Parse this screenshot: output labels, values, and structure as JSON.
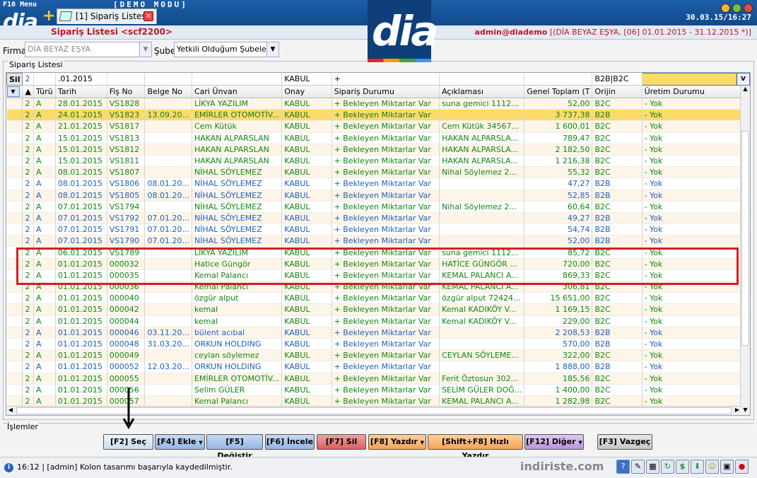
{
  "app": {
    "menu": "F10 Menu",
    "demo": "[DEMO  MODU]",
    "clock": "30.03.15/16:27",
    "logo": "dia",
    "tab_label": "[1] Sipariş Listesi"
  },
  "titlebar": {
    "title": "Sipariş Listesi <scf2200>",
    "user": "admin@diademo",
    "context": "[(DİA BEYAZ EŞYA, [06] 01.01.2015 - 31.12.2015 *)]"
  },
  "filters": {
    "firma_label": "Firma",
    "firma_value": "DİA BEYAZ EŞYA",
    "sube_label": "Şube",
    "sube_value": "Yetkili Olduğum Şubeler"
  },
  "section_label": "Sipariş Listesi",
  "filter_row": {
    "sil": "Sil",
    "date": ".01.2015",
    "onay": "KABUL",
    "durum": "+",
    "orijin": "B2B|B2C",
    "v": "v"
  },
  "columns": [
    "Türü",
    "Tarih",
    "Fiş No",
    "Belge No",
    "Cari Ünvan",
    "Onay",
    "Sipariş Durumu",
    "Açıklaması",
    "Genel Toplam (T",
    "Orijin",
    "Üretim Durumu"
  ],
  "rows": [
    {
      "c": "g",
      "t": "A",
      "d": "28.01.2015",
      "f": "VS1828",
      "b": "",
      "u": "LİKYA YAZILIM",
      "o": "KABUL",
      "s": "+ Bekleyen Miktarlar Var",
      "a": "suna gemici  1112...",
      "g2": "52,00",
      "r": "B2C",
      "p": "- Yok"
    },
    {
      "c": "g",
      "t": "A",
      "d": "24.01.2015",
      "f": "VS1823",
      "b": "13.09.20...",
      "u": "EMİRLER OTOMOTİV...",
      "o": "KABUL",
      "s": "+ Bekleyen Miktarlar Var",
      "a": "",
      "g2": "3 737,38",
      "r": "B2B",
      "p": "- Yok"
    },
    {
      "c": "g",
      "t": "A",
      "d": "21.01.2015",
      "f": "VS1817",
      "b": "",
      "u": "Cem Kütük",
      "o": "KABUL",
      "s": "+ Bekleyen Miktarlar Var",
      "a": "Cem Kütük  34567...",
      "g2": "1 600,01",
      "r": "B2C",
      "p": "- Yok"
    },
    {
      "c": "g",
      "t": "A",
      "d": "15.01.2015",
      "f": "VS1813",
      "b": "",
      "u": "HAKAN ALPARSLAN",
      "o": "KABUL",
      "s": "+ Bekleyen Miktarlar Var",
      "a": "HAKAN ALPARSLA...",
      "g2": "789,47",
      "r": "B2C",
      "p": "- Yok"
    },
    {
      "c": "g",
      "t": "A",
      "d": "15.01.2015",
      "f": "VS1812",
      "b": "",
      "u": "HAKAN ALPARSLAN",
      "o": "KABUL",
      "s": "+ Bekleyen Miktarlar Var",
      "a": "HAKAN ALPARSLA...",
      "g2": "2 182,50",
      "r": "B2C",
      "p": "- Yok"
    },
    {
      "c": "g",
      "t": "A",
      "d": "15.01.2015",
      "f": "VS1811",
      "b": "",
      "u": "HAKAN ALPARSLAN",
      "o": "KABUL",
      "s": "+ Bekleyen Miktarlar Var",
      "a": "HAKAN ALPARSLA...",
      "g2": "1 216,38",
      "r": "B2C",
      "p": "- Yok"
    },
    {
      "c": "g",
      "t": "A",
      "d": "08.01.2015",
      "f": "VS1807",
      "b": "",
      "u": "NİHAL SÖYLEMEZ",
      "o": "KABUL",
      "s": "+ Bekleyen Miktarlar Var",
      "a": "Nihal Söylemez  2...",
      "g2": "55,32",
      "r": "B2C",
      "p": "- Yok"
    },
    {
      "c": "b",
      "t": "A",
      "d": "08.01.2015",
      "f": "VS1806",
      "b": "08.01.20...",
      "u": "NİHAL SÖYLEMEZ",
      "o": "KABUL",
      "s": "+ Bekleyen Miktarlar Var",
      "a": "",
      "g2": "47,27",
      "r": "B2B",
      "p": "- Yok"
    },
    {
      "c": "b",
      "t": "A",
      "d": "08.01.2015",
      "f": "VS1805",
      "b": "08.01.20...",
      "u": "NİHAL SÖYLEMEZ",
      "o": "KABUL",
      "s": "+ Bekleyen Miktarlar Var",
      "a": "",
      "g2": "52,85",
      "r": "B2B",
      "p": "- Yok"
    },
    {
      "c": "g",
      "t": "A",
      "d": "07.01.2015",
      "f": "VS1794",
      "b": "",
      "u": "NİHAL SÖYLEMEZ",
      "o": "KABUL",
      "s": "+ Bekleyen Miktarlar Var",
      "a": "Nihal Söylemez  2...",
      "g2": "60,64",
      "r": "B2C",
      "p": "- Yok"
    },
    {
      "c": "b",
      "t": "A",
      "d": "07.01.2015",
      "f": "VS1792",
      "b": "07.01.20...",
      "u": "NİHAL SÖYLEMEZ",
      "o": "KABUL",
      "s": "+ Bekleyen Miktarlar Var",
      "a": "",
      "g2": "49,27",
      "r": "B2B",
      "p": "- Yok"
    },
    {
      "c": "b",
      "t": "A",
      "d": "07.01.2015",
      "f": "VS1791",
      "b": "07.01.20...",
      "u": "NİHAL SÖYLEMEZ",
      "o": "KABUL",
      "s": "+ Bekleyen Miktarlar Var",
      "a": "",
      "g2": "54,74",
      "r": "B2B",
      "p": "- Yok"
    },
    {
      "c": "b",
      "t": "A",
      "d": "07.01.2015",
      "f": "VS1790",
      "b": "07.01.20...",
      "u": "NİHAL SÖYLEMEZ",
      "o": "KABUL",
      "s": "+ Bekleyen Miktarlar Var",
      "a": "",
      "g2": "52,00",
      "r": "B2B",
      "p": "- Yok"
    },
    {
      "c": "g",
      "t": "A",
      "d": "06.01.2015",
      "f": "VS1789",
      "b": "",
      "u": "LİKYA YAZILIM",
      "o": "KABUL",
      "s": "+ Bekleyen Miktarlar Var",
      "a": "suna gemici  1112...",
      "g2": "85,72",
      "r": "B2C",
      "p": "- Yok"
    },
    {
      "c": "g",
      "t": "A",
      "d": "01.01.2015",
      "f": "000032",
      "b": "",
      "u": "Hatice Güngör",
      "o": "KABUL",
      "s": "+ Bekleyen Miktarlar Var",
      "a": "HATİCE GÜNGÖR  ...",
      "g2": "720,00",
      "r": "B2C",
      "p": "- Yok"
    },
    {
      "c": "g",
      "t": "A",
      "d": "01.01.2015",
      "f": "000035",
      "b": "",
      "u": "Kemal Palancı",
      "o": "KABUL",
      "s": "+ Bekleyen Miktarlar Var",
      "a": "KEMAL PALANCI A...",
      "g2": "869,33",
      "r": "B2C",
      "p": "- Yok"
    },
    {
      "c": "g",
      "t": "A",
      "d": "01.01.2015",
      "f": "000036",
      "b": "",
      "u": "Kemal Palancı",
      "o": "KABUL",
      "s": "+ Bekleyen Miktarlar Var",
      "a": "KEMAL PALANCI A...",
      "g2": "306,81",
      "r": "B2C",
      "p": "- Yok"
    },
    {
      "c": "g",
      "t": "A",
      "d": "01.01.2015",
      "f": "000040",
      "b": "",
      "u": "özgür alput",
      "o": "KABUL",
      "s": "+ Bekleyen Miktarlar Var",
      "a": "özgür alput  72424...",
      "g2": "15 651,00",
      "r": "B2C",
      "p": "- Yok"
    },
    {
      "c": "g",
      "t": "A",
      "d": "01.01.2015",
      "f": "000042",
      "b": "",
      "u": "kemal",
      "o": "KABUL",
      "s": "+ Bekleyen Miktarlar Var",
      "a": "Kemal KADIKÖY V...",
      "g2": "1 169,15",
      "r": "B2C",
      "p": "- Yok"
    },
    {
      "c": "g",
      "t": "A",
      "d": "01.01.2015",
      "f": "000044",
      "b": "",
      "u": "kemal",
      "o": "KABUL",
      "s": "+ Bekleyen Miktarlar Var",
      "a": "Kemal KADIKÖY V...",
      "g2": "229,00",
      "r": "B2C",
      "p": "- Yok"
    },
    {
      "c": "b",
      "t": "A",
      "d": "01.01.2015",
      "f": "000046",
      "b": "03.11.20...",
      "u": "bülent acıbal",
      "o": "KABUL",
      "s": "+ Bekleyen Miktarlar Var",
      "a": "",
      "g2": "2 208,53",
      "r": "B2B",
      "p": "- Yok"
    },
    {
      "c": "b",
      "t": "A",
      "d": "01.01.2015",
      "f": "000048",
      "b": "31.03.20...",
      "u": "ORKUN HOLDING",
      "o": "KABUL",
      "s": "+ Bekleyen Miktarlar Var",
      "a": "",
      "g2": "570,00",
      "r": "B2B",
      "p": "- Yok"
    },
    {
      "c": "g",
      "t": "A",
      "d": "01.01.2015",
      "f": "000049",
      "b": "",
      "u": "ceylan söylemez",
      "o": "KABUL",
      "s": "+ Bekleyen Miktarlar Var",
      "a": "CEYLAN SÖYLEME...",
      "g2": "322,00",
      "r": "B2C",
      "p": "- Yok"
    },
    {
      "c": "b",
      "t": "A",
      "d": "01.01.2015",
      "f": "000052",
      "b": "12.03.20...",
      "u": "ORKUN HOLDING",
      "o": "KABUL",
      "s": "+ Bekleyen Miktarlar Var",
      "a": "",
      "g2": "1 888,00",
      "r": "B2B",
      "p": "- Yok"
    },
    {
      "c": "g",
      "t": "A",
      "d": "01.01.2015",
      "f": "000055",
      "b": "",
      "u": "EMİRLER OTOMOTİV...",
      "o": "KABUL",
      "s": "+ Bekleyen Miktarlar Var",
      "a": "Ferit Öztosun  302...",
      "g2": "185,56",
      "r": "B2C",
      "p": "- Yok"
    },
    {
      "c": "g",
      "t": "A",
      "d": "01.01.2015",
      "f": "000056",
      "b": "",
      "u": "Selim GÜLER",
      "o": "KABUL",
      "s": "+ Bekleyen Miktarlar Var",
      "a": "SELİM GÜLER DOĞ...",
      "g2": "1 400,00",
      "r": "B2C",
      "p": "- Yok"
    },
    {
      "c": "g",
      "t": "A",
      "d": "01.01.2015",
      "f": "000057",
      "b": "",
      "u": "Kemal Palancı",
      "o": "KABUL",
      "s": "+ Bekleyen Miktarlar Var",
      "a": "KEMAL PALANCI A...",
      "g2": "1 282,98",
      "r": "B2C",
      "p": "- Yok"
    }
  ],
  "actions_label": "İşlemler",
  "buttons": {
    "sec": "[F2] Seç",
    "ekle": "[F4] Ekle",
    "degistir": "[F5] Değiştir",
    "incele": "[F6] İncele",
    "sil": "[F7] Sil",
    "yazdir": "[F8] Yazdır",
    "hizli": "[Shift+F8] Hızlı Yazdır",
    "diger": "[F12] Diğer",
    "vazgec": "[F3] Vazgeç"
  },
  "status": {
    "time": "16:12",
    "message": "16:12 | [admin] Kolon tasarımı başarıyla kaydedilmiştir.",
    "watermark": "indiriste.com"
  },
  "colors": {
    "green_text": "#118811",
    "blue_text": "#1f5fbf",
    "highlight_row": "#fddb6a",
    "red_box": "#d51d22",
    "brand_blue": "#0e3f7a"
  }
}
